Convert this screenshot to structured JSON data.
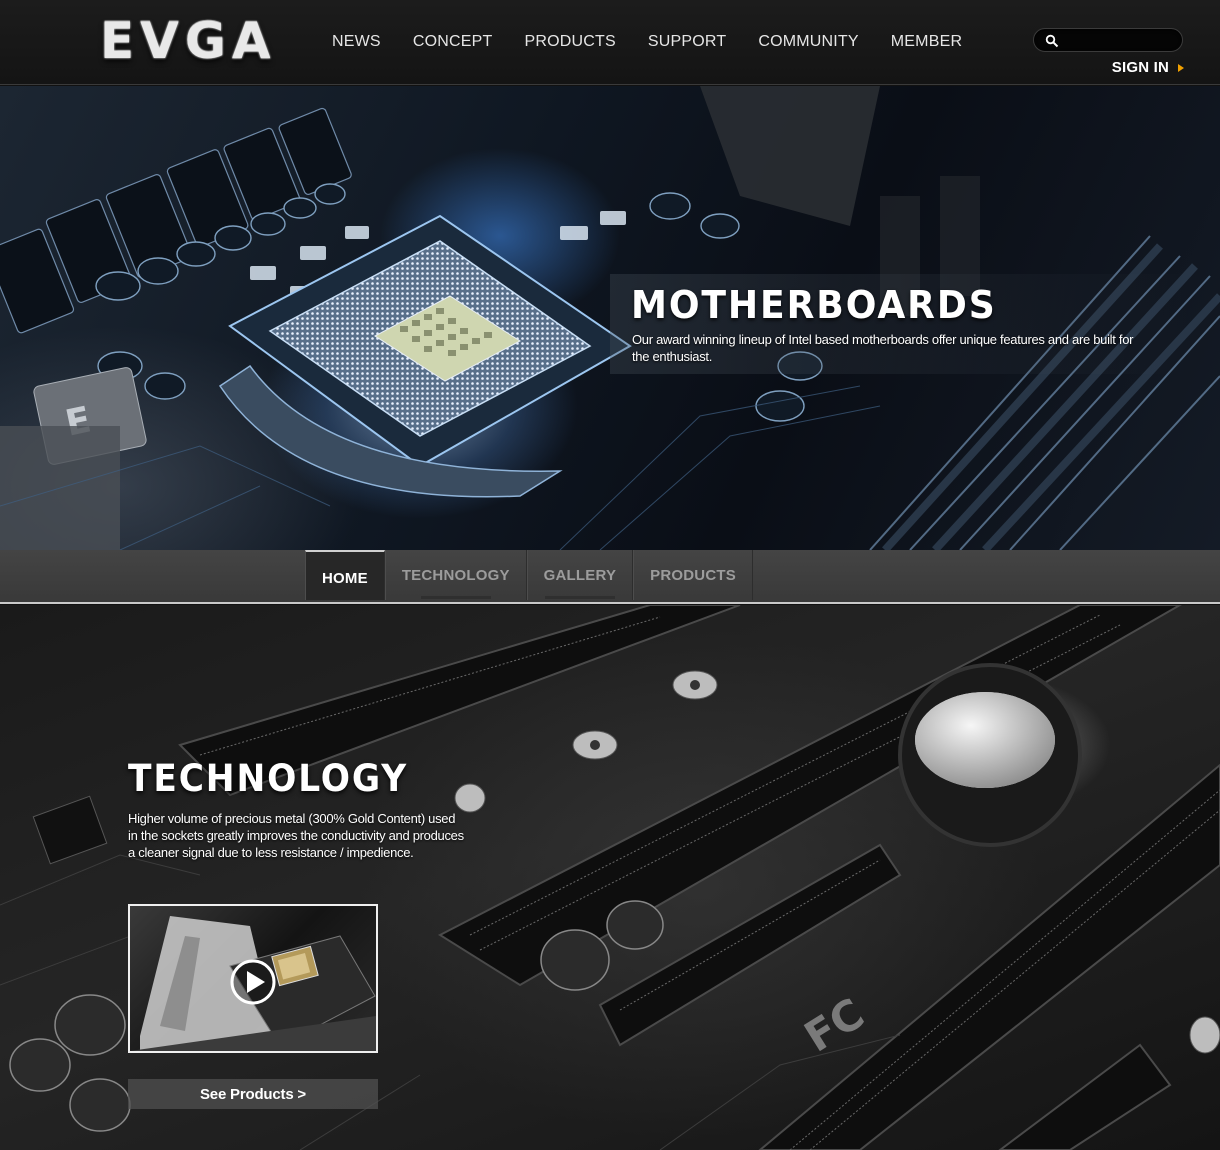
{
  "header": {
    "logo_text": "EVGA",
    "nav": [
      "NEWS",
      "CONCEPT",
      "PRODUCTS",
      "SUPPORT",
      "COMMUNITY",
      "MEMBER"
    ],
    "search_placeholder": "",
    "sign_in": "SIGN IN"
  },
  "hero": {
    "title": "MOTHERBOARDS",
    "description": "Our award winning lineup of Intel based motherboards offer unique features and are built for the enthusiast."
  },
  "subnav": {
    "tabs": [
      "HOME",
      "TECHNOLOGY",
      "GALLERY",
      "PRODUCTS"
    ],
    "active": "HOME"
  },
  "technology": {
    "title": "TECHNOLOGY",
    "description": "Higher volume of precious metal (300% Gold Content) used in the sockets greatly improves the conductivity and produces a cleaner signal due to less resistance / impedience.",
    "cta": "See Products >"
  },
  "icons": {
    "search": "search-icon",
    "sign_in_arrow": "arrow-right-icon",
    "play": "play-icon"
  },
  "colors": {
    "accent": "#f0a000",
    "header_bg": "#1a1a1a",
    "subnav_bg": "#3f3f3f",
    "tab_active_bg": "#272727"
  }
}
